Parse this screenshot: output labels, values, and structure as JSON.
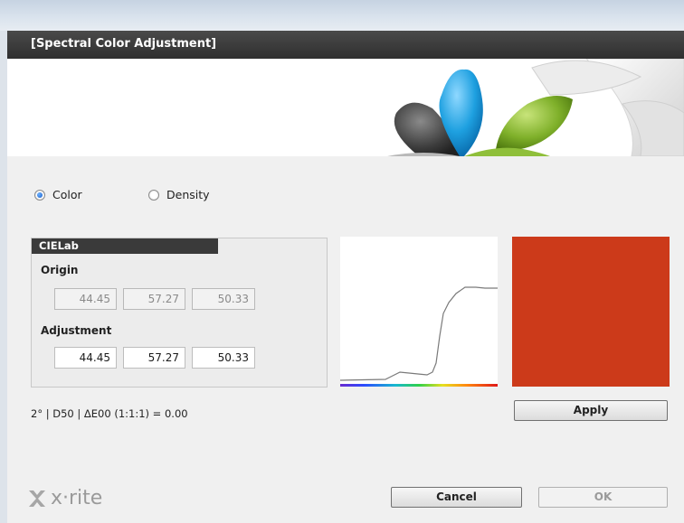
{
  "dialog": {
    "title": "[Spectral Color Adjustment]"
  },
  "mode": {
    "options": [
      {
        "label": "Color",
        "checked": true
      },
      {
        "label": "Density",
        "checked": false
      }
    ]
  },
  "cielab": {
    "header": "CIELab",
    "origin_label": "Origin",
    "origin_values": [
      "44.45",
      "57.27",
      "50.33"
    ],
    "adjustment_label": "Adjustment",
    "adjustment_values": [
      "44.45",
      "57.27",
      "50.33"
    ]
  },
  "swatch": {
    "color": "#cc3a1a"
  },
  "status": {
    "text": "2° | D50 | ΔE00 (1:1:1) = 0.00"
  },
  "buttons": {
    "apply": "Apply",
    "cancel": "Cancel",
    "ok": "OK"
  },
  "brand": {
    "logo_text": "x·rite"
  },
  "icons": {
    "radio": "radio-button",
    "logo": "xrite-logo-icon",
    "spectral": "spectral-curve"
  }
}
